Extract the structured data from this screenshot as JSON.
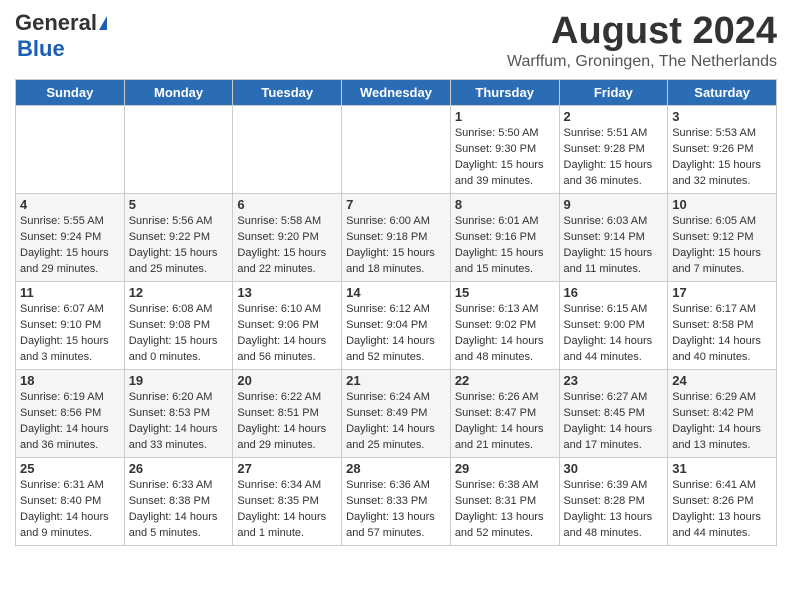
{
  "header": {
    "logo_general": "General",
    "logo_blue": "Blue",
    "month_title": "August 2024",
    "location": "Warffum, Groningen, The Netherlands"
  },
  "weekdays": [
    "Sunday",
    "Monday",
    "Tuesday",
    "Wednesday",
    "Thursday",
    "Friday",
    "Saturday"
  ],
  "weeks": [
    [
      {
        "day": "",
        "info": ""
      },
      {
        "day": "",
        "info": ""
      },
      {
        "day": "",
        "info": ""
      },
      {
        "day": "",
        "info": ""
      },
      {
        "day": "1",
        "info": "Sunrise: 5:50 AM\nSunset: 9:30 PM\nDaylight: 15 hours\nand 39 minutes."
      },
      {
        "day": "2",
        "info": "Sunrise: 5:51 AM\nSunset: 9:28 PM\nDaylight: 15 hours\nand 36 minutes."
      },
      {
        "day": "3",
        "info": "Sunrise: 5:53 AM\nSunset: 9:26 PM\nDaylight: 15 hours\nand 32 minutes."
      }
    ],
    [
      {
        "day": "4",
        "info": "Sunrise: 5:55 AM\nSunset: 9:24 PM\nDaylight: 15 hours\nand 29 minutes."
      },
      {
        "day": "5",
        "info": "Sunrise: 5:56 AM\nSunset: 9:22 PM\nDaylight: 15 hours\nand 25 minutes."
      },
      {
        "day": "6",
        "info": "Sunrise: 5:58 AM\nSunset: 9:20 PM\nDaylight: 15 hours\nand 22 minutes."
      },
      {
        "day": "7",
        "info": "Sunrise: 6:00 AM\nSunset: 9:18 PM\nDaylight: 15 hours\nand 18 minutes."
      },
      {
        "day": "8",
        "info": "Sunrise: 6:01 AM\nSunset: 9:16 PM\nDaylight: 15 hours\nand 15 minutes."
      },
      {
        "day": "9",
        "info": "Sunrise: 6:03 AM\nSunset: 9:14 PM\nDaylight: 15 hours\nand 11 minutes."
      },
      {
        "day": "10",
        "info": "Sunrise: 6:05 AM\nSunset: 9:12 PM\nDaylight: 15 hours\nand 7 minutes."
      }
    ],
    [
      {
        "day": "11",
        "info": "Sunrise: 6:07 AM\nSunset: 9:10 PM\nDaylight: 15 hours\nand 3 minutes."
      },
      {
        "day": "12",
        "info": "Sunrise: 6:08 AM\nSunset: 9:08 PM\nDaylight: 15 hours\nand 0 minutes."
      },
      {
        "day": "13",
        "info": "Sunrise: 6:10 AM\nSunset: 9:06 PM\nDaylight: 14 hours\nand 56 minutes."
      },
      {
        "day": "14",
        "info": "Sunrise: 6:12 AM\nSunset: 9:04 PM\nDaylight: 14 hours\nand 52 minutes."
      },
      {
        "day": "15",
        "info": "Sunrise: 6:13 AM\nSunset: 9:02 PM\nDaylight: 14 hours\nand 48 minutes."
      },
      {
        "day": "16",
        "info": "Sunrise: 6:15 AM\nSunset: 9:00 PM\nDaylight: 14 hours\nand 44 minutes."
      },
      {
        "day": "17",
        "info": "Sunrise: 6:17 AM\nSunset: 8:58 PM\nDaylight: 14 hours\nand 40 minutes."
      }
    ],
    [
      {
        "day": "18",
        "info": "Sunrise: 6:19 AM\nSunset: 8:56 PM\nDaylight: 14 hours\nand 36 minutes."
      },
      {
        "day": "19",
        "info": "Sunrise: 6:20 AM\nSunset: 8:53 PM\nDaylight: 14 hours\nand 33 minutes."
      },
      {
        "day": "20",
        "info": "Sunrise: 6:22 AM\nSunset: 8:51 PM\nDaylight: 14 hours\nand 29 minutes."
      },
      {
        "day": "21",
        "info": "Sunrise: 6:24 AM\nSunset: 8:49 PM\nDaylight: 14 hours\nand 25 minutes."
      },
      {
        "day": "22",
        "info": "Sunrise: 6:26 AM\nSunset: 8:47 PM\nDaylight: 14 hours\nand 21 minutes."
      },
      {
        "day": "23",
        "info": "Sunrise: 6:27 AM\nSunset: 8:45 PM\nDaylight: 14 hours\nand 17 minutes."
      },
      {
        "day": "24",
        "info": "Sunrise: 6:29 AM\nSunset: 8:42 PM\nDaylight: 14 hours\nand 13 minutes."
      }
    ],
    [
      {
        "day": "25",
        "info": "Sunrise: 6:31 AM\nSunset: 8:40 PM\nDaylight: 14 hours\nand 9 minutes."
      },
      {
        "day": "26",
        "info": "Sunrise: 6:33 AM\nSunset: 8:38 PM\nDaylight: 14 hours\nand 5 minutes."
      },
      {
        "day": "27",
        "info": "Sunrise: 6:34 AM\nSunset: 8:35 PM\nDaylight: 14 hours\nand 1 minute."
      },
      {
        "day": "28",
        "info": "Sunrise: 6:36 AM\nSunset: 8:33 PM\nDaylight: 13 hours\nand 57 minutes."
      },
      {
        "day": "29",
        "info": "Sunrise: 6:38 AM\nSunset: 8:31 PM\nDaylight: 13 hours\nand 52 minutes."
      },
      {
        "day": "30",
        "info": "Sunrise: 6:39 AM\nSunset: 8:28 PM\nDaylight: 13 hours\nand 48 minutes."
      },
      {
        "day": "31",
        "info": "Sunrise: 6:41 AM\nSunset: 8:26 PM\nDaylight: 13 hours\nand 44 minutes."
      }
    ]
  ]
}
